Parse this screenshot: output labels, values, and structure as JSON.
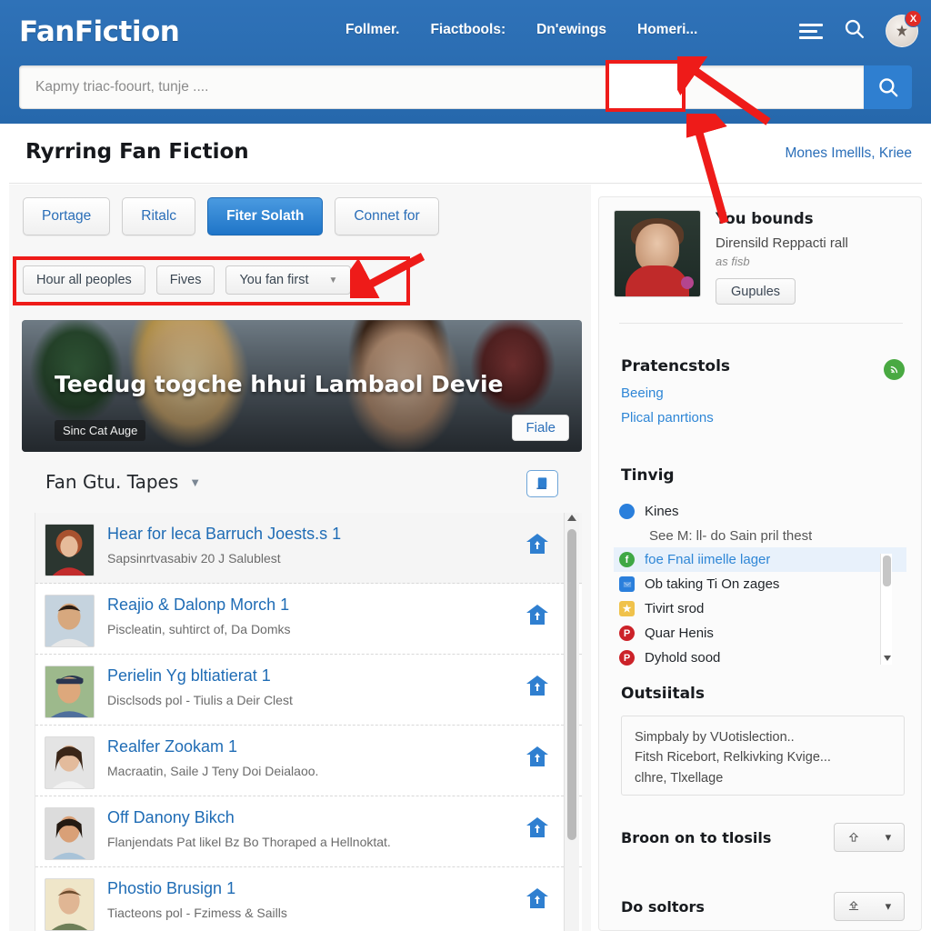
{
  "header": {
    "brand": "FanFiction",
    "nav": [
      {
        "label": "Follmer."
      },
      {
        "label": "Fiactbools:"
      },
      {
        "label": "Dn'ewings"
      },
      {
        "label": "Homeri..."
      }
    ],
    "menu_icon": "hamburger-icon",
    "search_icon": "search-icon",
    "avatar_icon": "user-avatar",
    "avatar_badge": "X",
    "search": {
      "placeholder": "Kapmy triac-foourt, tunje ....",
      "value": "",
      "button_icon": "search-icon"
    },
    "bg_color": "#2a6db5"
  },
  "titlebar": {
    "title": "Ryrring Fan Fiction",
    "right_link": "Mones Imellls, Kriee"
  },
  "tabs": [
    {
      "label": "Portage",
      "active": false
    },
    {
      "label": "Ritalc",
      "active": false
    },
    {
      "label": "Fiter Solath",
      "active": true
    },
    {
      "label": "Connet for",
      "active": false
    }
  ],
  "filters": [
    {
      "label": "Hour all peoples",
      "caret": false
    },
    {
      "label": "Fives",
      "caret": false
    },
    {
      "label": "You fan first",
      "caret": true
    }
  ],
  "hero": {
    "title": "Teedug togche hhui Lambaol Devie",
    "tag": "Sinc Cat Auge",
    "button": "Fiale"
  },
  "list_header": {
    "title": "Fan Gtu. Tapes",
    "caret": "chevron-down-icon",
    "save_icon": "save-book-icon"
  },
  "list": [
    {
      "title": "Hear for leca Barruch Joests.s 1",
      "sub": "Sapsinrtvasabiv 20 J Salublest",
      "icon": "upload-home-icon"
    },
    {
      "title": "Reajio & Dalonp Morch 1",
      "sub": "Piscleatin, suhtirct of, Da Domks",
      "icon": "upload-home-icon"
    },
    {
      "title": "Perielin Yg bltiatierat 1",
      "sub": "Disclsods pol - Tiulis a Deir Clest",
      "icon": "upload-home-icon"
    },
    {
      "title": "Realfer Zookam 1",
      "sub": "Macraatin, Saile J Teny Doi Deialaoo.",
      "icon": "upload-home-icon"
    },
    {
      "title": "Off Danony Bikch",
      "sub": "Flanjendats Pat likel Bz Bo Thoraped a Hellnoktat.",
      "icon": "upload-home-icon"
    },
    {
      "title": "Phostio Brusign 1",
      "sub": "Tiacteons pol - Fzimess & Saills",
      "icon": "upload-home-icon"
    }
  ],
  "sidebar": {
    "profile": {
      "name": "You bounds",
      "desc": "Dirensild Reppacti rall",
      "sub": "as fisb",
      "button": "Gupules"
    },
    "section_links": {
      "title": "Pratencstols",
      "rss_icon": "rss-icon",
      "links": [
        "Beeing",
        "Plical panrtions"
      ]
    },
    "trending": {
      "title": "Tinvig",
      "items": [
        {
          "label": "Kines",
          "icon": "blue-dot-icon",
          "color": "#2a7fdc",
          "selected": false,
          "note": false
        },
        {
          "label": "See M: ll- do Sain pril thest",
          "icon": "",
          "color": "",
          "selected": false,
          "note": true
        },
        {
          "label": "foe Fnal iimelle lager",
          "icon": "f",
          "color": "#3fa845",
          "selected": true,
          "note": false
        },
        {
          "label": "Ob taking Ti On zages",
          "icon": "m",
          "color": "#2a7fdc",
          "selected": false,
          "note": false,
          "square": true
        },
        {
          "label": "Tivirt srod",
          "icon": "a",
          "color": "#f0c24b",
          "selected": false,
          "note": false,
          "square": true
        },
        {
          "label": "Quar Henis",
          "icon": "P",
          "color": "#cc2229",
          "selected": false,
          "note": false
        },
        {
          "label": "Dyhold sood",
          "icon": "P",
          "color": "#cc2229",
          "selected": false,
          "note": false
        }
      ]
    },
    "outsitals": {
      "title": "Outsiitals",
      "lines": [
        "Simpbaly by VUotislection..",
        "Fitsh Ricebort, Relkivking Kvige...",
        "clhre, Tlxellage"
      ]
    },
    "selects": [
      {
        "label": "Broon on to tlosils",
        "icon": "upload-icon",
        "caret": "chevron-down-icon"
      },
      {
        "label": "Do soltors",
        "icon": "share-icon",
        "caret": "chevron-down-icon"
      }
    ]
  },
  "annotations": {
    "box_color": "#ee1b19",
    "arrow_color": "#ee1b19",
    "boxes": [
      "search-bar-region",
      "filter-pill-row"
    ],
    "arrows": 2
  }
}
